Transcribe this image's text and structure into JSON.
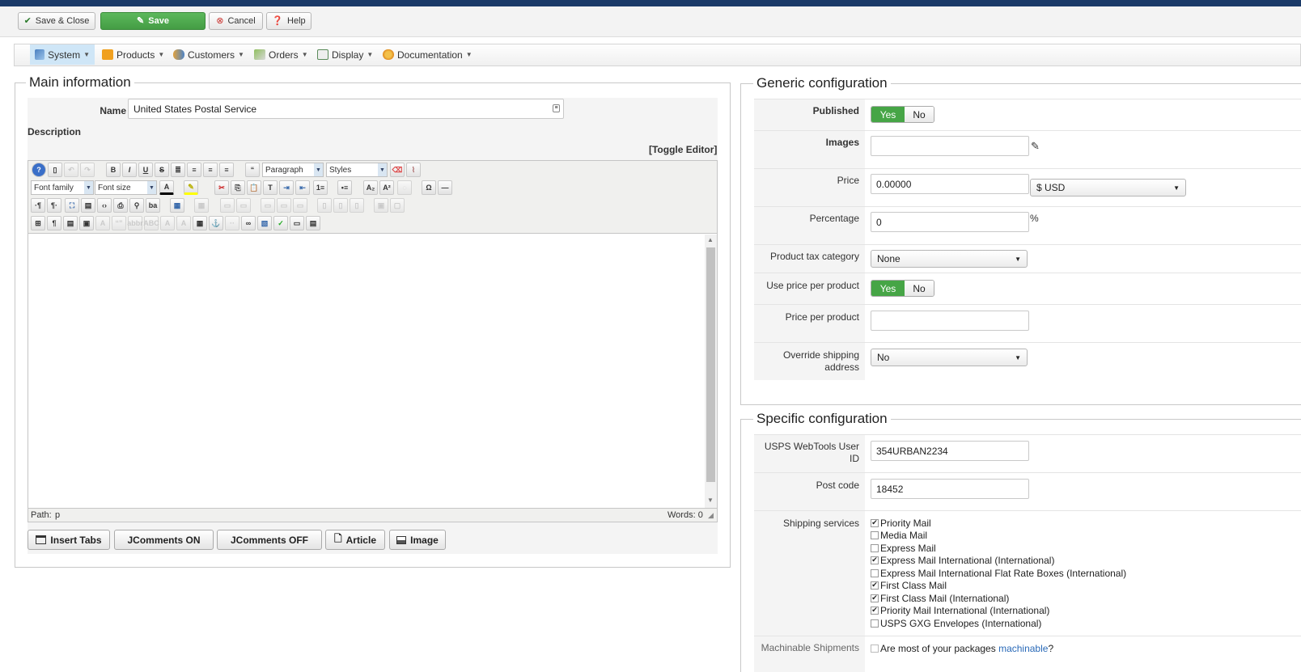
{
  "toolbar": {
    "save_close": "Save & Close",
    "save": "Save",
    "cancel": "Cancel",
    "help": "Help"
  },
  "menu": {
    "items": [
      {
        "label": "System",
        "icon": "tools-icon"
      },
      {
        "label": "Products",
        "icon": "products-icon"
      },
      {
        "label": "Customers",
        "icon": "customers-icon"
      },
      {
        "label": "Orders",
        "icon": "orders-icon"
      },
      {
        "label": "Display",
        "icon": "display-icon"
      },
      {
        "label": "Documentation",
        "icon": "documentation-icon"
      }
    ]
  },
  "main": {
    "legend": "Main information",
    "name_label": "Name",
    "name_value": "United States Postal Service",
    "description_label": "Description",
    "toggle_editor": "[Toggle Editor]",
    "editor": {
      "paragraph": "Paragraph",
      "styles": "Styles",
      "font_family": "Font family",
      "font_size": "Font size",
      "path_label": "Path:",
      "path_value": "p",
      "words_label": "Words: 0"
    },
    "buttons": {
      "insert_tabs": "Insert Tabs",
      "jcomments_on": "JComments ON",
      "jcomments_off": "JComments OFF",
      "article": "Article",
      "image": "Image"
    }
  },
  "generic": {
    "legend": "Generic configuration",
    "published_label": "Published",
    "yes": "Yes",
    "no": "No",
    "images_label": "Images",
    "price_label": "Price",
    "price_value": "0.00000",
    "currency": "$ USD",
    "percentage_label": "Percentage",
    "percentage_value": "0",
    "percent_sign": "%",
    "tax_label": "Product tax category",
    "tax_value": "None",
    "use_ppp_label": "Use price per product",
    "ppp_label": "Price per product",
    "override_label_1": "Override shipping",
    "override_label_2": "address",
    "override_value": "No"
  },
  "specific": {
    "legend": "Specific configuration",
    "userid_label_1": "USPS WebTools User",
    "userid_label_2": "ID",
    "userid_value": "354URBAN2234",
    "postcode_label": "Post code",
    "postcode_value": "18452",
    "services_label": "Shipping services",
    "services": [
      {
        "label": "Priority Mail",
        "checked": true
      },
      {
        "label": "Media Mail",
        "checked": false
      },
      {
        "label": "Express Mail",
        "checked": false
      },
      {
        "label": "Express Mail International (International)",
        "checked": true
      },
      {
        "label": "Express Mail International Flat Rate Boxes (International)",
        "checked": false
      },
      {
        "label": "First Class Mail",
        "checked": true
      },
      {
        "label": "First Class Mail (International)",
        "checked": true
      },
      {
        "label": "Priority Mail International (International)",
        "checked": true
      },
      {
        "label": "USPS GXG Envelopes (International)",
        "checked": false
      }
    ],
    "machinable_label": "Machinable Shipments",
    "machinable_question_pre": "Are most of your packages ",
    "machinable_link": "machinable",
    "machinable_question_post": "?"
  },
  "colors": {
    "topbar": "#1b3a68",
    "save_green": "#5cb85c",
    "toggle_yes": "#46a546",
    "link": "#2a6ab8"
  }
}
